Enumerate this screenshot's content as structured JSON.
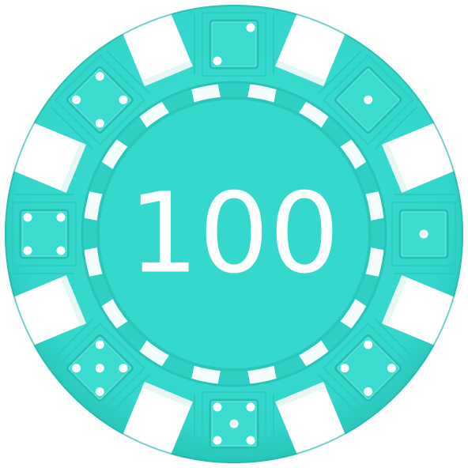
{
  "chip": {
    "value": "100",
    "dice_faces": [
      2,
      1,
      1,
      4,
      5,
      5,
      4,
      4
    ],
    "colors": {
      "base": "#33d6cb",
      "base_dark": "#22b9ae",
      "inlay": "#3bdbd0",
      "stripe": "#ffffff",
      "pip": "#ffffff",
      "text": "#ffffff"
    }
  }
}
